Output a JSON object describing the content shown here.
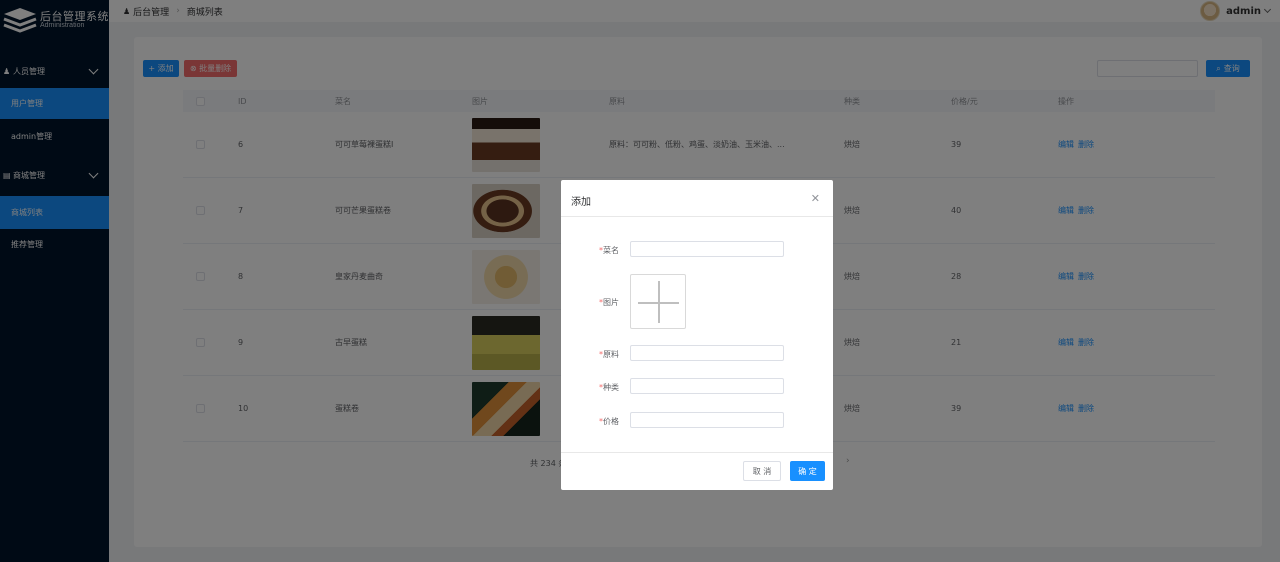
{
  "app": {
    "title": "后台管理系统",
    "subtitle": "Administration"
  },
  "sidebar": {
    "groups": [
      {
        "label": "人员管理",
        "icon": "users-icon",
        "items": [
          {
            "label": "用户管理",
            "active": true
          },
          {
            "label": "admin管理",
            "active": false
          }
        ]
      },
      {
        "label": "商城管理",
        "icon": "shop-icon",
        "items": [
          {
            "label": "商城列表",
            "active": true
          },
          {
            "label": "推荐管理",
            "active": false
          }
        ]
      }
    ]
  },
  "header": {
    "breadcrumb": [
      "后台管理",
      "商城列表"
    ],
    "user": "admin"
  },
  "toolbar": {
    "add_label": "+ 添加",
    "batch_delete_label": "⊗ 批量删除",
    "search_placeholder": "",
    "query_label": "查询"
  },
  "table": {
    "columns": [
      "ID",
      "菜名",
      "图片",
      "原料",
      "种类",
      "价格/元",
      "操作"
    ],
    "rows": [
      {
        "id": "6",
        "name": "可可草莓裸蛋糕I",
        "material": "原料：可可粉、低粉、鸡蛋、淡奶油、玉米油、...",
        "kind": "烘焙",
        "price": "39"
      },
      {
        "id": "7",
        "name": "可可芒果蛋糕卷",
        "material": "",
        "kind": "烘焙",
        "price": "40"
      },
      {
        "id": "8",
        "name": "皇家丹麦曲奇",
        "material": "",
        "kind": "烘焙",
        "price": "28"
      },
      {
        "id": "9",
        "name": "古早蛋糕",
        "material": "",
        "kind": "烘焙",
        "price": "21"
      },
      {
        "id": "10",
        "name": "蛋糕卷",
        "material": "",
        "kind": "烘焙",
        "price": "39"
      }
    ],
    "edit_label": "编辑",
    "delete_label": "删除"
  },
  "pagination": {
    "total_text": "共 234 条"
  },
  "dialog": {
    "title": "添加",
    "fields": [
      {
        "label": "菜名",
        "required": true
      },
      {
        "label": "图片",
        "required": true
      },
      {
        "label": "原料",
        "required": true
      },
      {
        "label": "种类",
        "required": true
      },
      {
        "label": "价格",
        "required": true
      }
    ],
    "cancel_label": "取 消",
    "confirm_label": "确 定"
  },
  "colors": {
    "primary": "#1890ff",
    "danger": "#f56c6c",
    "sidebar_bg": "#00152a"
  }
}
